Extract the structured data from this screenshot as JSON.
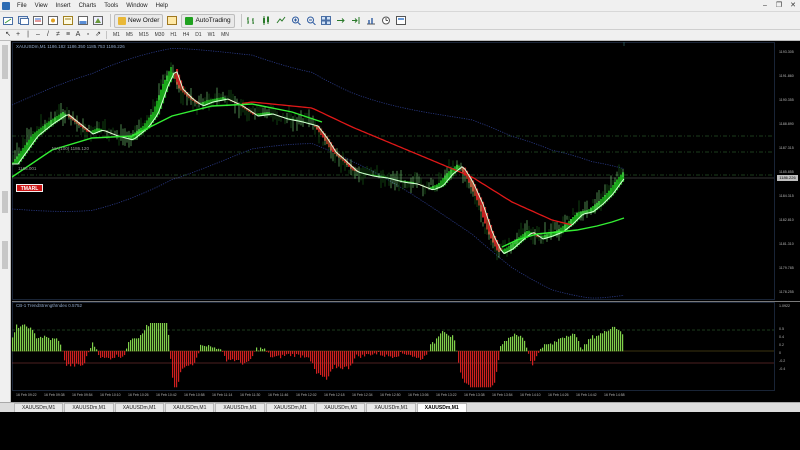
{
  "menu": {
    "items": [
      "File",
      "View",
      "Insert",
      "Charts",
      "Tools",
      "Window",
      "Help"
    ]
  },
  "toolbar": {
    "new_order_label": "New Order",
    "autotrading_label": "AutoTrading"
  },
  "timeframes": [
    "M1",
    "M5",
    "M15",
    "M30",
    "H1",
    "H4",
    "D1",
    "W1",
    "MN"
  ],
  "chart": {
    "title": "XAUUSDm,M1  1186.182 1186.350 1185.753 1186.226",
    "ma_label_1": "MA(100) 1186.120",
    "ma_label_2": "1186.001",
    "current_price": "1186.226",
    "badge": "TMARL",
    "price_axis": [
      "1193.305",
      "1191.860",
      "1190.355",
      "1188.890",
      "1187.315",
      "1185.855",
      "1184.315",
      "1182.810",
      "1181.310",
      "1179.785",
      "1178.255"
    ],
    "time_axis": [
      "16 Feb 09:22",
      "16 Feb 09:38",
      "16 Feb 09:54",
      "16 Feb 10:10",
      "16 Feb 10:26",
      "16 Feb 10:42",
      "16 Feb 10:58",
      "16 Feb 11:14",
      "16 Feb 11:30",
      "16 Feb 11:46",
      "16 Feb 12:02",
      "16 Feb 12:18",
      "16 Feb 12:34",
      "16 Feb 12:50",
      "16 Feb 13:06",
      "16 Feb 13:22",
      "16 Feb 13:38",
      "16 Feb 13:54",
      "16 Feb 14:10",
      "16 Feb 14:26",
      "16 Feb 14:42",
      "16 Feb 14:58"
    ]
  },
  "subwindow": {
    "title": "CB-1 TrendStrengthIndex 0.5752",
    "axis": [
      "1.0922",
      "0.5",
      "0.4",
      "0.2",
      "0",
      "-0.2",
      "-0.4"
    ]
  },
  "tabs": [
    "XAUUSDm,M1",
    "XAUUSDm,M1",
    "XAUUSDm,M1",
    "XAUUSDm,M1",
    "XAUUSDm,M1",
    "XAUUSDm,M1",
    "XAUUSDm,M1",
    "XAUUSDm,M1",
    "XAUUSDm,M1"
  ],
  "active_tab_index": 8,
  "colors": {
    "background": "#000000",
    "bull_fill": "#1aa81a",
    "bear_fill": "#c52222",
    "ma_fast": "#d8ffd8",
    "ma_slow": "#e01818",
    "trend_line": "#33ee33",
    "bands": "#2a3a88",
    "grid_dash": "#3a7a3a",
    "hist_pos": "#7fd04a",
    "hist_neg": "#d02020"
  }
}
